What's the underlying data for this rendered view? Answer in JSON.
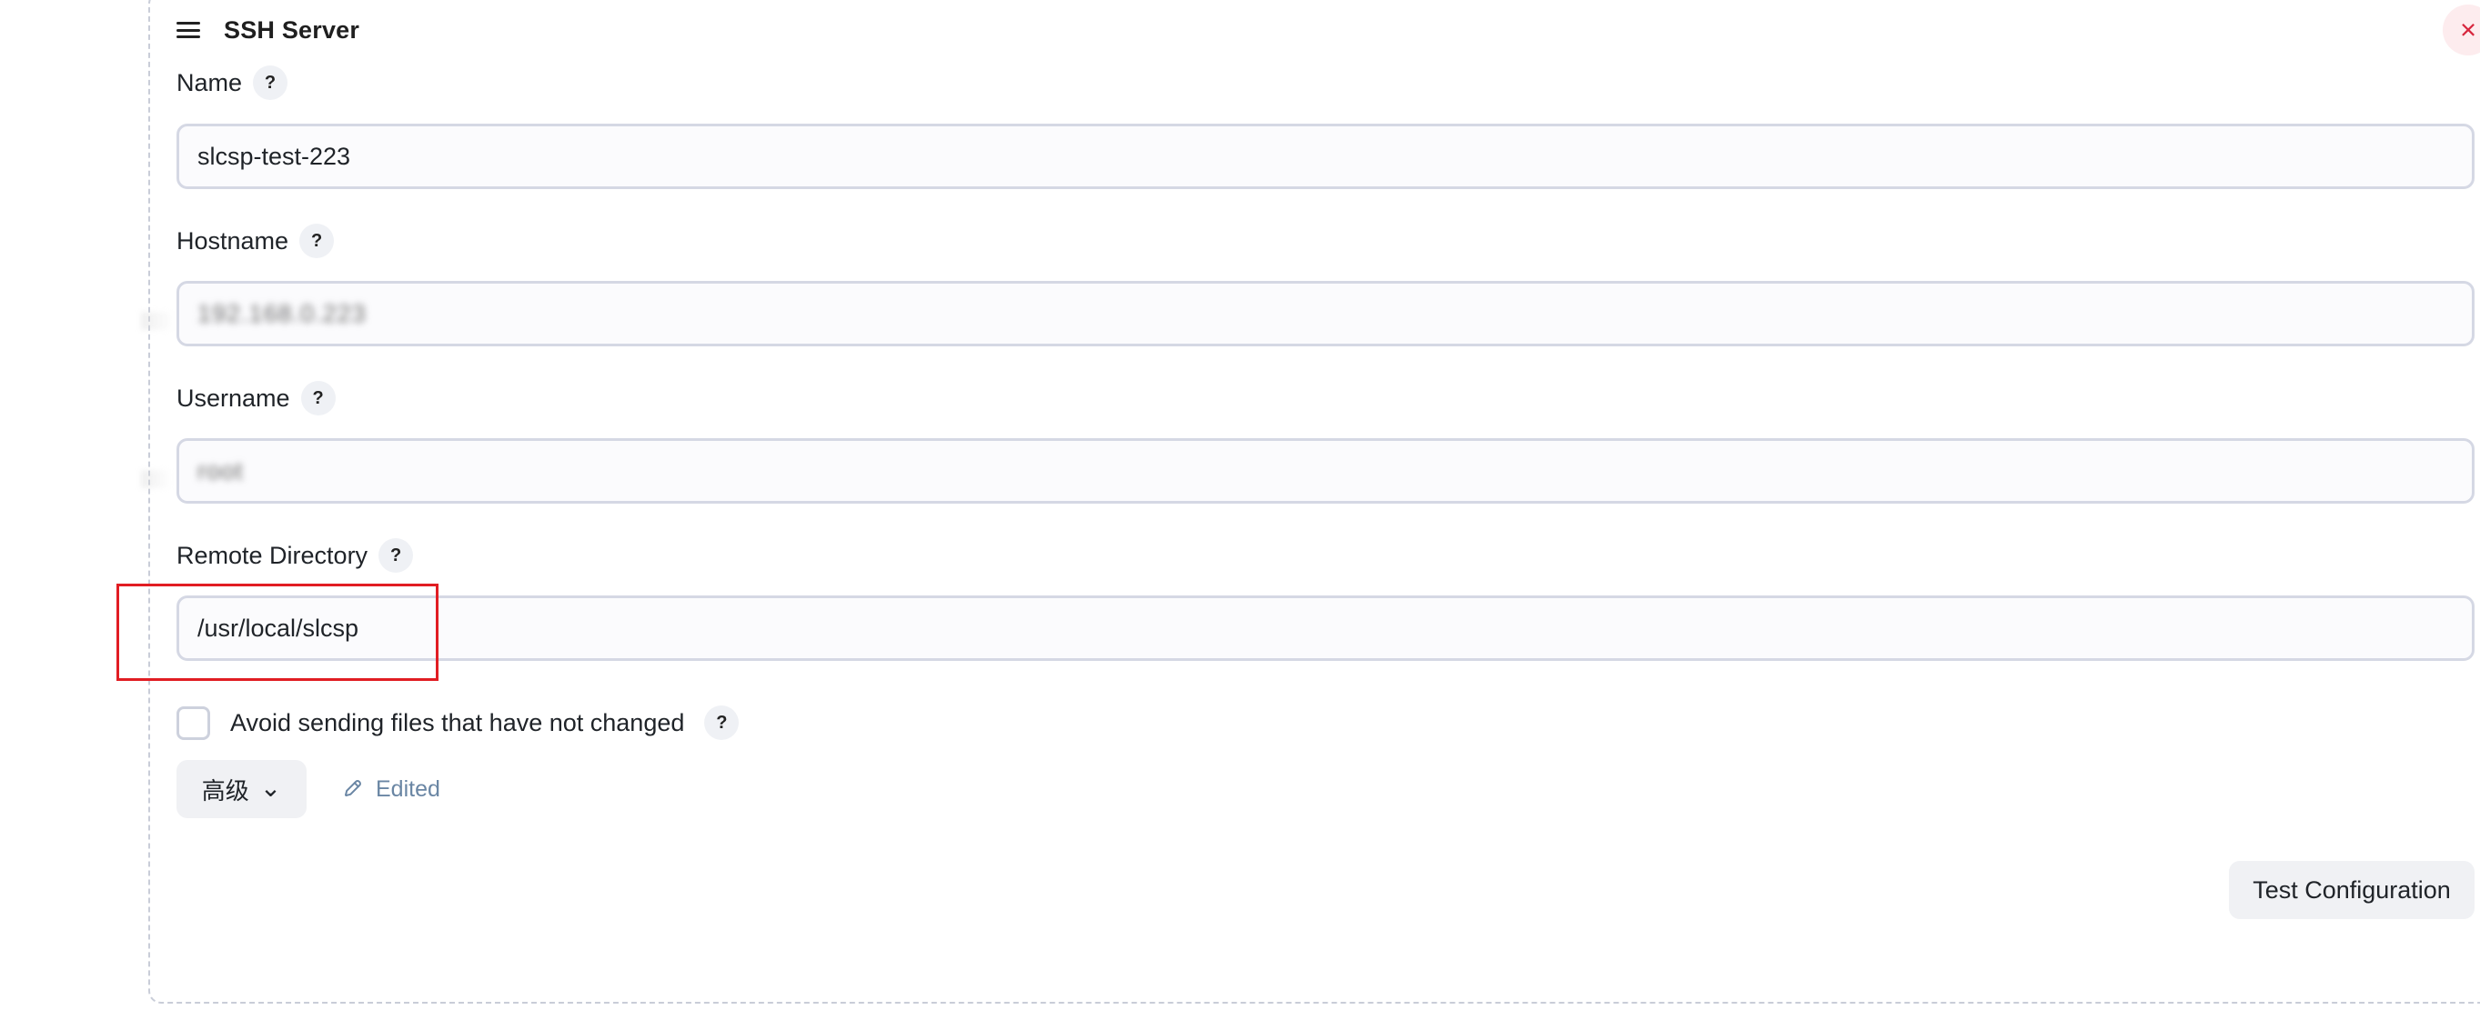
{
  "header": {
    "title": "SSH Server",
    "menu_icon": "hamburger-icon",
    "close_icon": "close-icon",
    "close_symbol": "×"
  },
  "fields": [
    {
      "label": "Name",
      "help": "?",
      "value": "slcsp-test-223"
    },
    {
      "label": "Hostname",
      "help": "?",
      "value": "192.168.0.223"
    },
    {
      "label": "Username",
      "help": "?",
      "value": "root"
    },
    {
      "label": "Remote Directory",
      "help": "?",
      "value": "/usr/local/slcsp"
    }
  ],
  "checkbox": {
    "label": "Avoid sending files that have not changed",
    "help": "?",
    "checked": false
  },
  "advanced": {
    "label": "高级",
    "chevron": "⌄",
    "edited_label": "Edited",
    "edited_icon": "pencil-icon"
  },
  "actions": {
    "test_configuration": "Test Configuration"
  },
  "colors": {
    "highlight": "#e11d23",
    "close": "#d7263d",
    "edited": "#6a86a4"
  }
}
